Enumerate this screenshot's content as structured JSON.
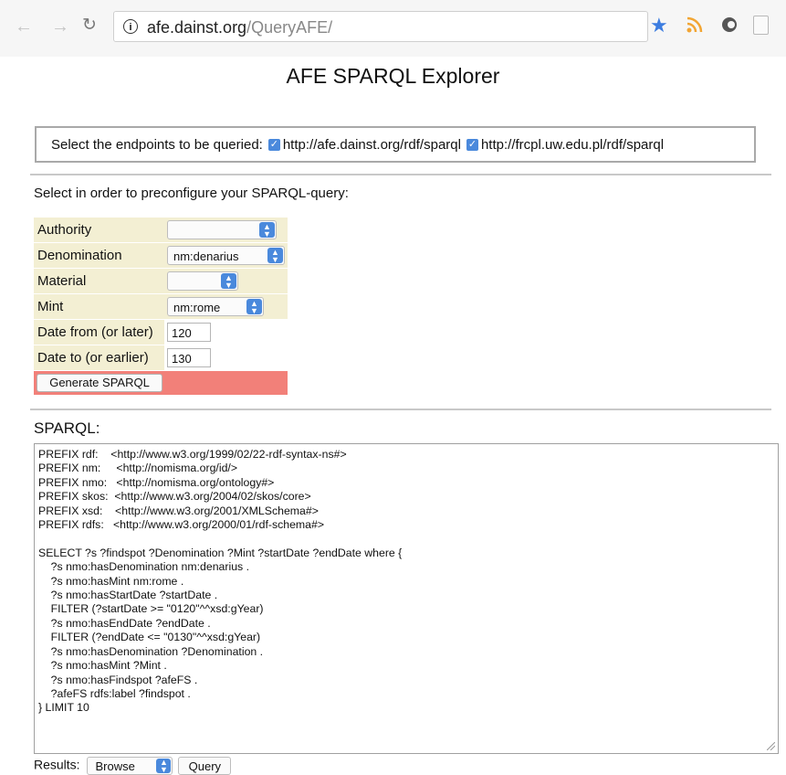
{
  "browser": {
    "url_host": "afe.dainst.org",
    "url_path": "/QueryAFE/",
    "accent_color": "#3d7de0"
  },
  "page": {
    "title": "AFE SPARQL Explorer"
  },
  "endpoints": {
    "label": "Select the endpoints to be queried:",
    "items": [
      {
        "url": "http://afe.dainst.org/rdf/sparql",
        "checked": true
      },
      {
        "url": "http://frcpl.uw.edu.pl/rdf/sparql",
        "checked": true
      }
    ]
  },
  "preconfig": {
    "instruction": "Select in order to preconfigure your SPARQL-query:",
    "fields": {
      "authority": {
        "label": "Authority",
        "value": ""
      },
      "denomination": {
        "label": "Denomination",
        "value": "nm:denarius"
      },
      "material": {
        "label": "Material",
        "value": ""
      },
      "mint": {
        "label": "Mint",
        "value": "nm:rome"
      },
      "date_from": {
        "label": "Date from (or later)",
        "value": "120"
      },
      "date_to": {
        "label": "Date to (or earlier)",
        "value": "130"
      }
    },
    "generate_label": "Generate SPARQL",
    "form_bg_color": "#f3efd3",
    "generate_row_color": "#f28079"
  },
  "sparql": {
    "heading": "SPARQL:",
    "query": "PREFIX rdf:    <http://www.w3.org/1999/02/22-rdf-syntax-ns#>\nPREFIX nm:     <http://nomisma.org/id/>\nPREFIX nmo:   <http://nomisma.org/ontology#>\nPREFIX skos:  <http://www.w3.org/2004/02/skos/core>\nPREFIX xsd:    <http://www.w3.org/2001/XMLSchema#>\nPREFIX rdfs:   <http://www.w3.org/2000/01/rdf-schema#>\n\nSELECT ?s ?findspot ?Denomination ?Mint ?startDate ?endDate where {\n    ?s nmo:hasDenomination nm:denarius .\n    ?s nmo:hasMint nm:rome .\n    ?s nmo:hasStartDate ?startDate .\n    FILTER (?startDate >= \"0120\"^^xsd:gYear)\n    ?s nmo:hasEndDate ?endDate .\n    FILTER (?endDate <= \"0130\"^^xsd:gYear)\n    ?s nmo:hasDenomination ?Denomination .\n    ?s nmo:hasMint ?Mint .\n    ?s nmo:hasFindspot ?afeFS .\n    ?afeFS rdfs:label ?findspot .\n} LIMIT 10"
  },
  "results": {
    "label": "Results:",
    "format_value": "Browse",
    "query_label": "Query"
  }
}
